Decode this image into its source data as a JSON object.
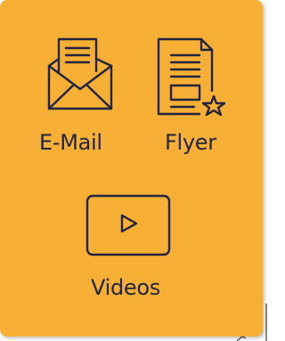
{
  "menu": {
    "items": [
      {
        "label": "E-Mail",
        "icon": "envelope-letter-icon"
      },
      {
        "label": "Flyer",
        "icon": "flyer-star-icon"
      },
      {
        "label": "Videos",
        "icon": "video-play-icon"
      }
    ]
  },
  "colors": {
    "panel_background": "#F7AF35",
    "icon_stroke": "#22253F",
    "label_text": "#22253F"
  }
}
